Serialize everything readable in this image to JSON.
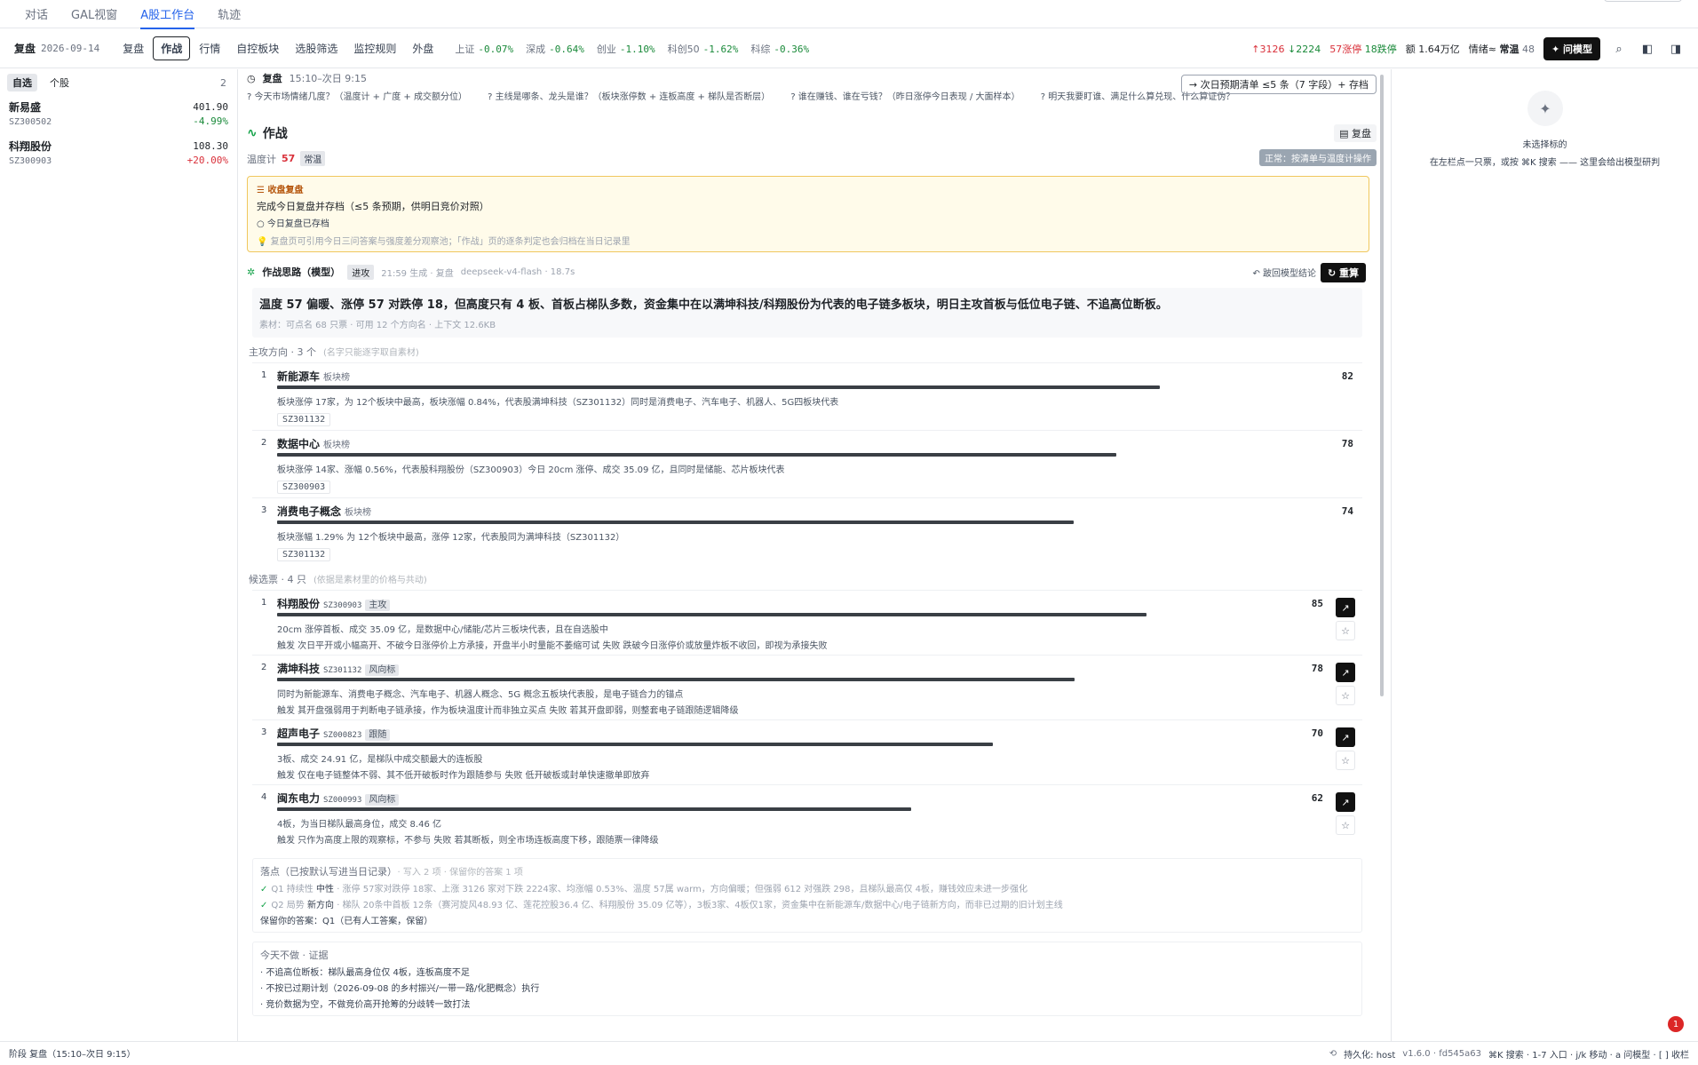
{
  "nav": {
    "tabs": [
      "对话",
      "GAL视窗",
      "A股工作台",
      "轨迹"
    ],
    "active": 2
  },
  "toolbar": {
    "phase": "复盘",
    "date": "2026-09-14",
    "modes": [
      "复盘",
      "作战",
      "行情",
      "自控板块",
      "选股筛选",
      "监控规则",
      "外盘"
    ],
    "active_mode": 1,
    "indices": [
      {
        "name": "上证",
        "change": "-0.07%"
      },
      {
        "name": "深成",
        "change": "-0.64%"
      },
      {
        "name": "创业",
        "change": "-1.10%"
      },
      {
        "name": "科创50",
        "change": "-1.62%"
      },
      {
        "name": "科综",
        "change": "-0.36%"
      }
    ],
    "breadth_up": "↑3126",
    "breadth_down": "↓2224",
    "limit_up": "57涨停",
    "limit_down": "18跌停",
    "turnover": "额 1.64万亿",
    "mood_label": "情绪≈",
    "mood_value": "常温",
    "mood_score": "48",
    "ask_label": "问模型"
  },
  "left": {
    "tabs": [
      "自选",
      "个股"
    ],
    "count": "2",
    "items": [
      {
        "name": "新易盛",
        "code": "SZ300502",
        "price": "401.90",
        "change": "-4.99%"
      },
      {
        "name": "科翔股份",
        "code": "SZ300903",
        "price": "108.30",
        "change": "+20.00%"
      }
    ]
  },
  "main": {
    "review_title": "复盘",
    "review_time": "15:10–次日 9:15",
    "next_button": "次日预期清单 ≤5 条（7 字段）+ 存档",
    "questions": [
      "? 今天市场情绪几度？（温度计 + 广度 + 成交额分位）",
      "? 主线是哪条、龙头是谁？（板块涨停数 + 连板高度 + 梯队是否断层）",
      "? 谁在赚钱、谁在亏钱？（昨日涨停今日表现 / 大面样本）",
      "? 明天我要盯谁、满足什么算兑现、什么算证伪？"
    ],
    "title": "作战",
    "review_btn": "复盘",
    "temp_label": "温度计",
    "temp_value": "57",
    "temp_badge": "常温",
    "norm_tag": "正常：按清单与温度计操作",
    "closing": {
      "label": "收盘复盘",
      "line1": "完成今日复盘并存档（≤5 条预期，供明日竞价对照）",
      "line2": "今日复盘已存档",
      "line3": "复盘页可引用今日三问答案与强度差分观察池；「作战」页的逐条判定也会归档在当日记录里"
    },
    "plan": {
      "title": "作战思路（模型）",
      "tag": "进攻",
      "meta": "21:59 生成 · 复盘",
      "model": "deepseek-v4-flash · 18.7s",
      "back": "跛回模型结论",
      "regen": "重算",
      "summary": "温度 57 偏暖、涨停 57 对跌停 18，但高度只有 4 板、首板占梯队多数，资金集中在以满坤科技/科翔股份为代表的电子链多板块，明日主攻首板与低位电子链、不追高位断板。",
      "material": "素材：可点名 68 只票 · 可用 12 个方向名 · 上下文 12.6KB",
      "directions_label": "主攻方向 · 3 个",
      "directions_sub": "(名字只能逐字取自素材)",
      "directions": [
        {
          "no": "1",
          "name": "新能源车",
          "tag": "板块榜",
          "score": 82,
          "desc": "板块涨停 17家，为 12个板块中最高，板块涨幅 0.84%，代表股满坤科技（SZ301132）同时是消费电子、汽车电子、机器人、5G四板块代表",
          "chip": "SZ301132"
        },
        {
          "no": "2",
          "name": "数据中心",
          "tag": "板块榜",
          "score": 78,
          "desc": "板块涨停 14家、涨幅 0.56%，代表股科翔股份（SZ300903）今日 20cm 涨停、成交 35.09 亿，且同时是储能、芯片板块代表",
          "chip": "SZ300903"
        },
        {
          "no": "3",
          "name": "消费电子概念",
          "tag": "板块榜",
          "score": 74,
          "desc": "板块涨幅 1.29% 为 12个板块中最高，涨停 12家，代表股同为满坤科技（SZ301132）",
          "chip": "SZ301132"
        }
      ],
      "candidates_label": "候选票 · 4 只",
      "candidates_sub": "(依据是素材里的价格与共动)",
      "candidates": [
        {
          "no": "1",
          "name": "科翔股份",
          "code": "SZ300903",
          "role": "主攻",
          "score": 85,
          "desc": "20cm 涨停首板、成交 35.09 亿，是数据中心/储能/芯片三板块代表，且在自选股中",
          "trigger": "触发 次日平开或小幅高开、不破今日涨停价上方承接，开盘半小时量能不萎缩可试  失败 跌破今日涨停价或放量炸板不收回，即视为承接失败"
        },
        {
          "no": "2",
          "name": "满坤科技",
          "code": "SZ301132",
          "role": "风向标",
          "score": 78,
          "desc": "同时为新能源车、消费电子概念、汽车电子、机器人概念、5G 概念五板块代表股，是电子链合力的锚点",
          "trigger": "触发 其开盘强弱用于判断电子链承接，作为板块温度计而非独立买点  失败 若其开盘即弱，则整套电子链跟随逻辑降级"
        },
        {
          "no": "3",
          "name": "超声电子",
          "code": "SZ000823",
          "role": "跟随",
          "score": 70,
          "desc": "3板、成交 24.91 亿，是梯队中成交额最大的连板股",
          "trigger": "触发 仅在电子链整体不弱、其不低开破板时作为跟随参与  失败 低开破板或封单快速撤单即放弃"
        },
        {
          "no": "4",
          "name": "闽东电力",
          "code": "SZ000993",
          "role": "风向标",
          "score": 62,
          "desc": "4板，为当日梯队最高身位，成交 8.46 亿",
          "trigger": "触发 只作为高度上限的观察标，不参与  失败 若其断板，则全市场连板高度下移，跟随票一律降级"
        }
      ],
      "landing_title": "落点（已按默认写进当日记录）",
      "landing_sub": "· 写入 2 项 · 保留你的答案 1 项",
      "landing": [
        {
          "q": "Q1 持续性",
          "v": "中性",
          "txt": "· 涨停 57家对跌停 18家、上涨 3126 家对下跌 2224家、均涨幅 0.53%、温度 57属 warm，方向偏暖；但强弱 612 对强跌 298，且梯队最高仅 4板，赚钱效应未进一步强化"
        },
        {
          "q": "Q2 局势",
          "v": "新方向",
          "txt": "· 梯队 20条中首板 12条（赛河旋风48.93 亿、莲花控股36.4 亿、科翔股份 35.09 亿等），3板3家、4板仅1家，资金集中在新能源车/数据中心/电子链新方向，而非已过期的旧计划主线"
        }
      ],
      "kept": "保留你的答案：Q1（已有人工答案，保留）",
      "skip_title": "今天不做 · 证据",
      "skip": [
        "· 不追高位断板：梯队最高身位仅 4板，连板高度不足",
        "· 不按已过期计划（2026-09-08 的乡村振兴/一带一路/化肥概念）执行",
        "· 竞价数据为空，不做竞价高开抢筹的分歧转一致打法"
      ]
    }
  },
  "right": {
    "title": "未选择标的",
    "hint": "在左栏点一只票，或按 ⌘K 搜索 —— 这里会给出模型研判",
    "badge": "1"
  },
  "status": {
    "left": "阶段 复盘（15:10–次日 9:15）",
    "persist": "持久化: host",
    "version": "v1.6.0 · fd545a63",
    "shortcuts": "⌘K 搜索 · 1-7 入口 · j/k 移动 · a 问模型 · [ ] 收栏"
  },
  "colors": {
    "accent": "#2563eb",
    "up": "#d9303a",
    "down": "#1a8a3a",
    "warn_bg": "#fffbea"
  }
}
